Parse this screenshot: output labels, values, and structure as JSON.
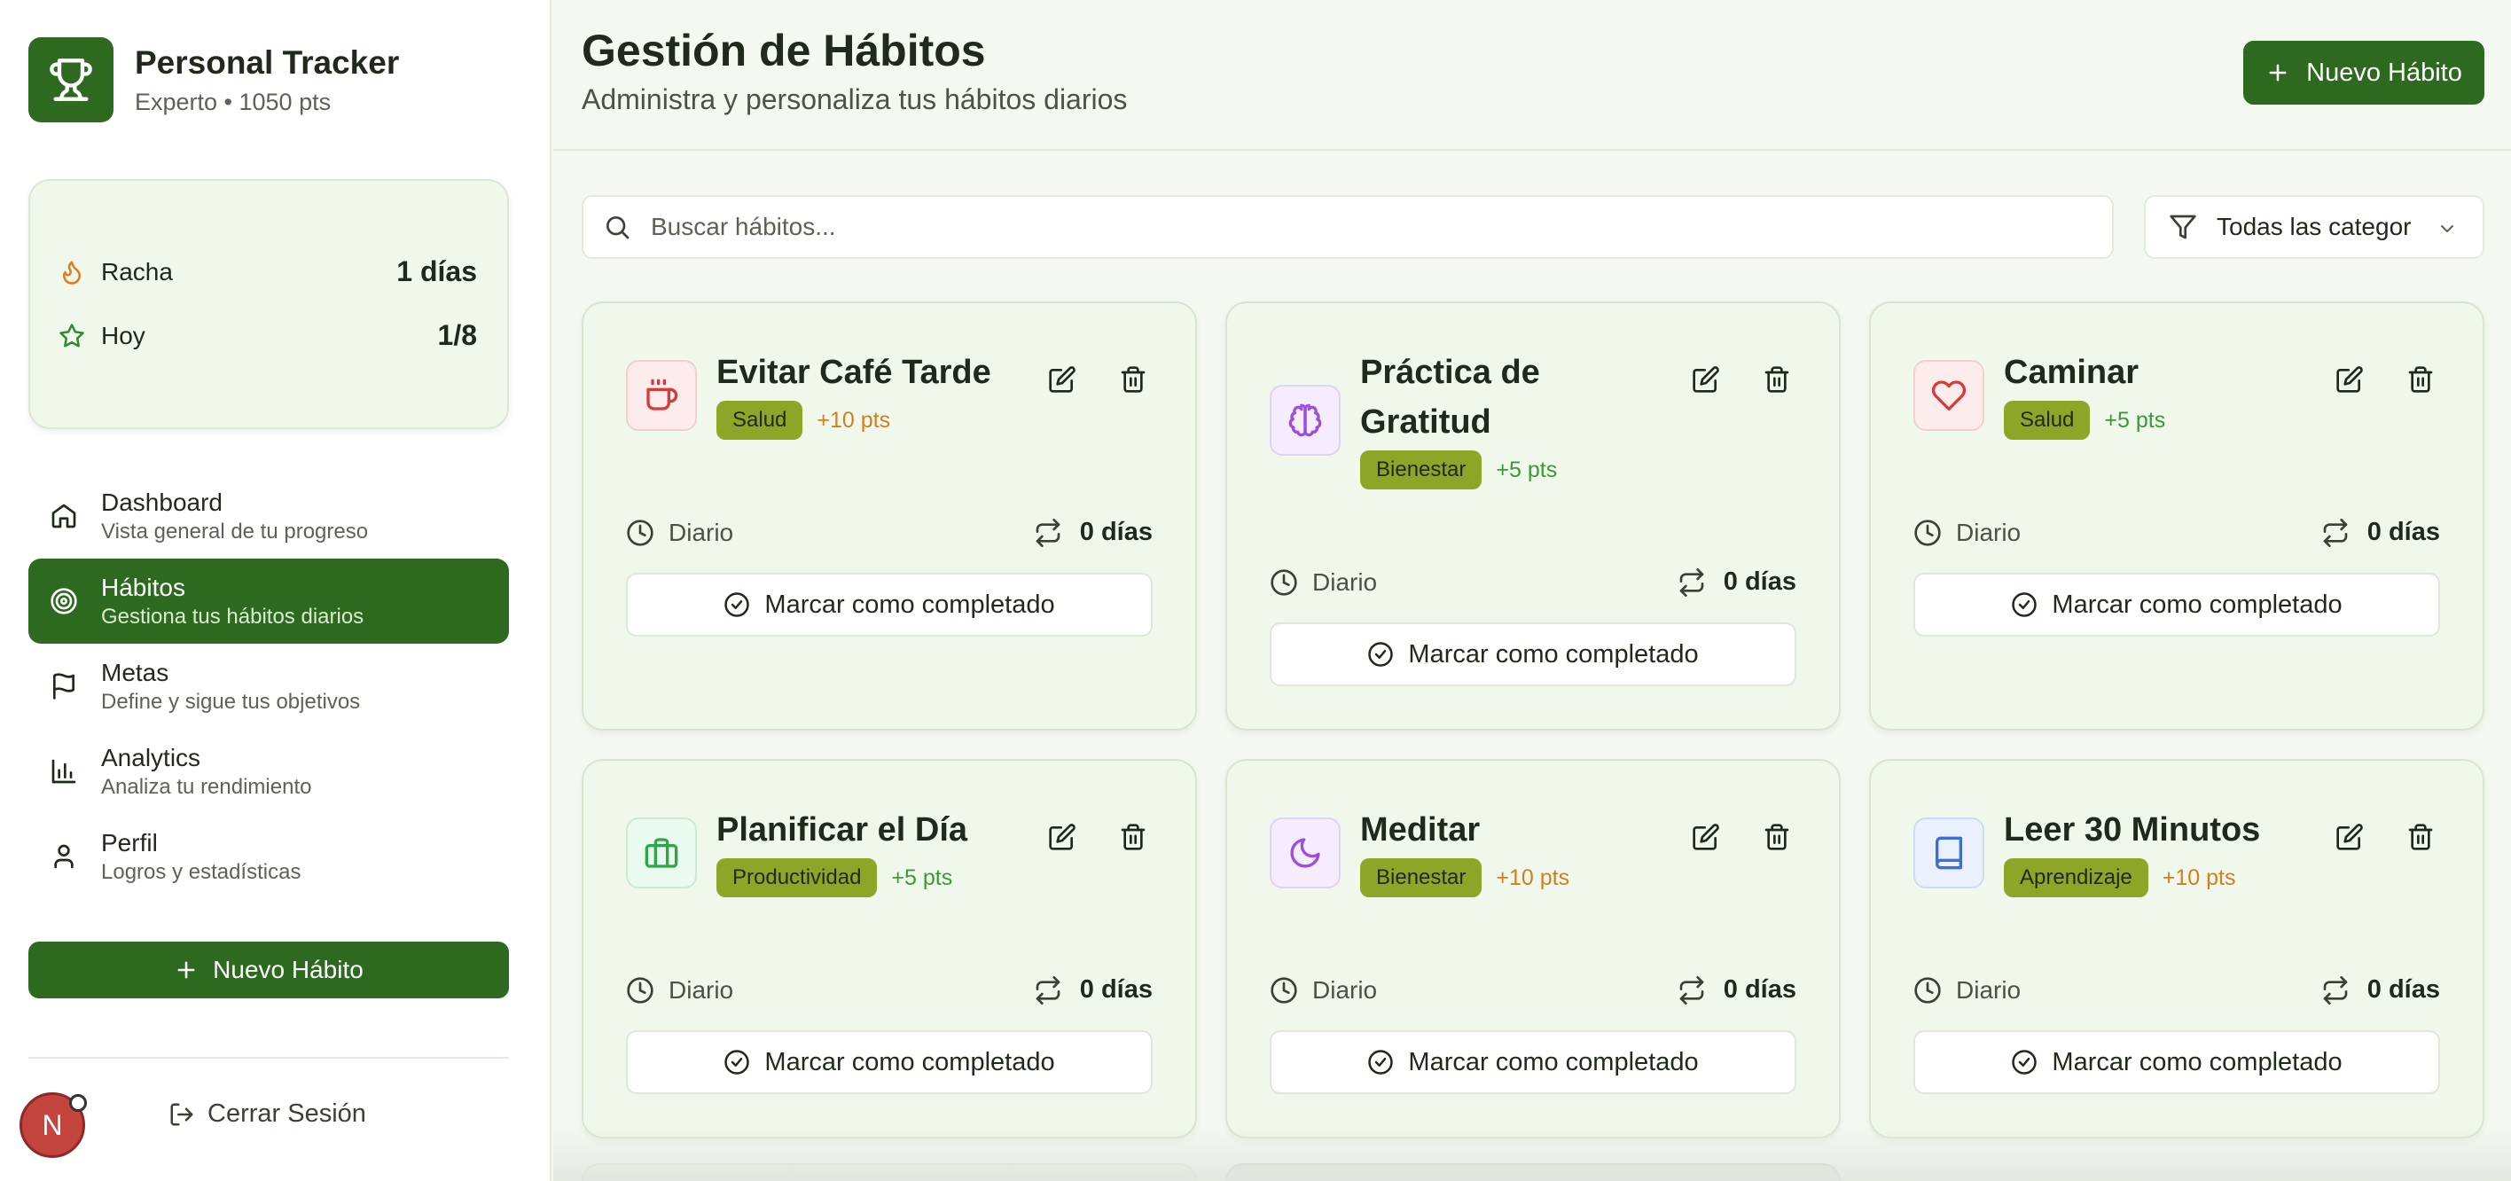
{
  "app": {
    "title": "Personal Tracker",
    "subtitle": "Experto • 1050 pts",
    "logo_icon": "trophy-icon"
  },
  "stats": {
    "streak_label": "Racha",
    "streak_value": "1 días",
    "today_label": "Hoy",
    "today_value": "1/8"
  },
  "nav": [
    {
      "title": "Dashboard",
      "sub": "Vista general de tu progreso",
      "icon": "home-icon"
    },
    {
      "title": "Hábitos",
      "sub": "Gestiona tus hábitos diarios",
      "icon": "target-icon",
      "active": true
    },
    {
      "title": "Metas",
      "sub": "Define y sigue tus objetivos",
      "icon": "flag-icon"
    },
    {
      "title": "Analytics",
      "sub": "Analiza tu rendimiento",
      "icon": "bar-chart-icon"
    },
    {
      "title": "Perfil",
      "sub": "Logros y estadísticas",
      "icon": "user-icon"
    }
  ],
  "sidebar": {
    "new_habit_label": "Nuevo Hábito",
    "logout_label": "Cerrar Sesión",
    "avatar_initial": "N"
  },
  "header": {
    "title": "Gestión de Hábitos",
    "subtitle": "Administra y personaliza tus hábitos diarios",
    "new_habit_label": "Nuevo Hábito"
  },
  "search": {
    "placeholder": "Buscar hábitos..."
  },
  "filter": {
    "selected": "Todas las categorías"
  },
  "colors": {
    "primary": "#2d6a1f",
    "tag": "#8ea628",
    "card_bg": "#eff8ea",
    "pts_orange": "#d0801e",
    "pts_green": "#3a9a3a"
  },
  "habits": [
    {
      "title": "Evitar Café Tarde",
      "category": "Salud",
      "points": "+10 pts",
      "frequency": "Diario",
      "streak": "0 días",
      "action": "Marcar como completado",
      "icon": "coffee-icon"
    },
    {
      "title": "Práctica de Gratitud",
      "category": "Bienestar",
      "points": "+5 pts",
      "frequency": "Diario",
      "streak": "0 días",
      "action": "Marcar como completado",
      "icon": "brain-icon"
    },
    {
      "title": "Caminar",
      "category": "Salud",
      "points": "+5 pts",
      "frequency": "Diario",
      "streak": "0 días",
      "action": "Marcar como completado",
      "icon": "heart-icon"
    },
    {
      "title": "Planificar el Día",
      "category": "Productividad",
      "points": "+5 pts",
      "frequency": "Diario",
      "streak": "0 días",
      "action": "Marcar como completado",
      "icon": "briefcase-icon"
    },
    {
      "title": "Meditar",
      "category": "Bienestar",
      "points": "+10 pts",
      "frequency": "Diario",
      "streak": "0 días",
      "action": "Marcar como completado",
      "icon": "moon-icon"
    },
    {
      "title": "Leer 30 Minutos",
      "category": "Aprendizaje",
      "points": "+10 pts",
      "frequency": "Diario",
      "streak": "0 días",
      "action": "Marcar como completado",
      "icon": "book-icon"
    }
  ]
}
